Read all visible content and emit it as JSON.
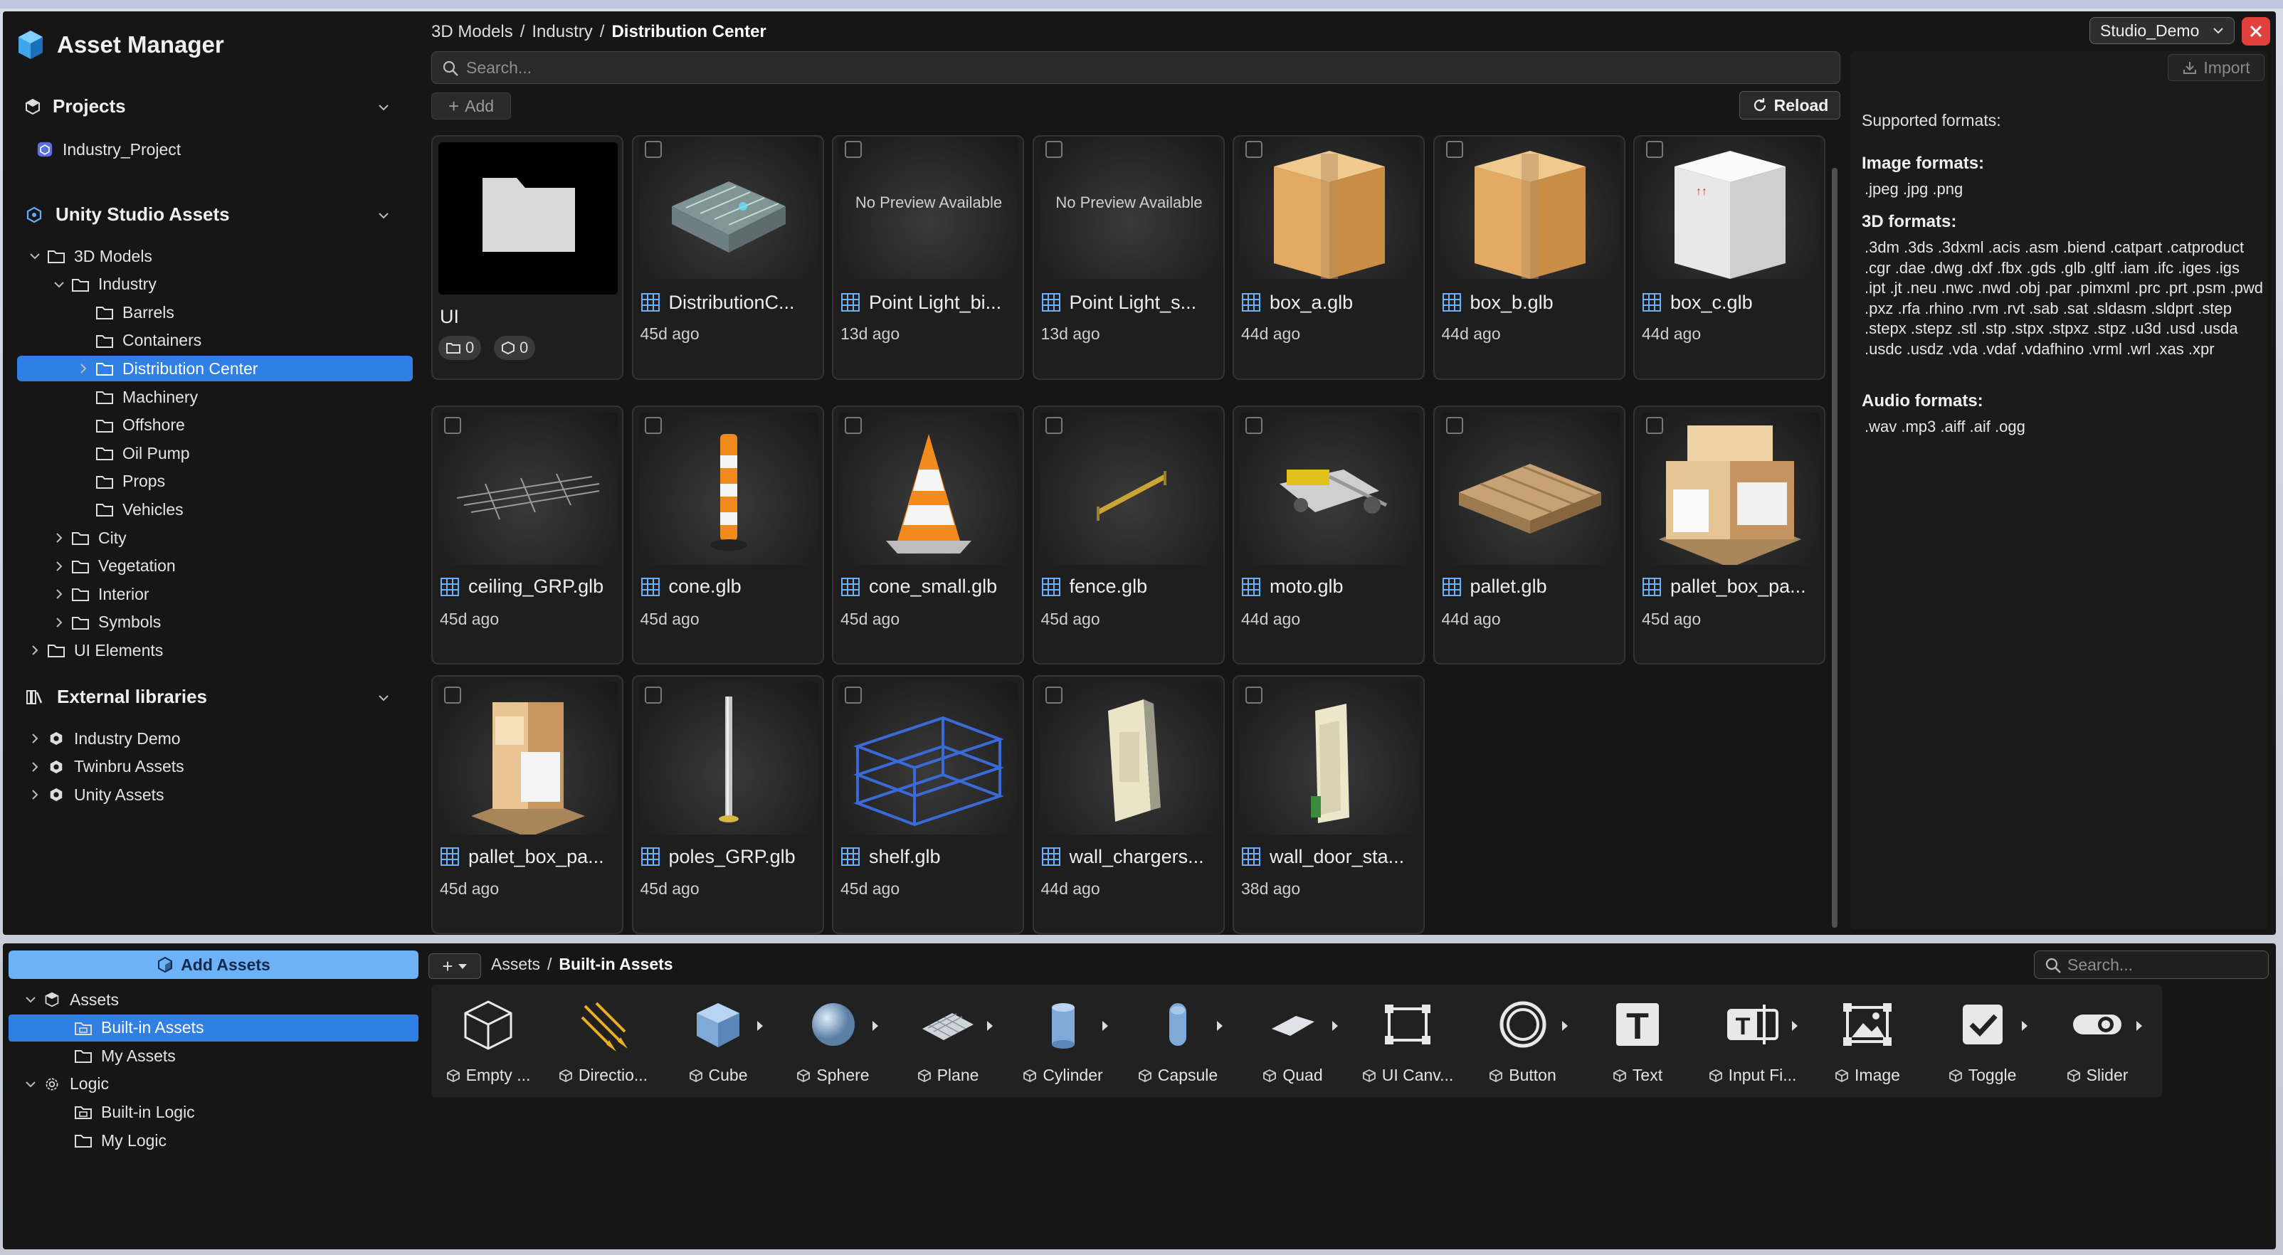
{
  "app_title": "Asset Manager",
  "sidebar": {
    "projects": {
      "label": "Projects",
      "items": [
        "Industry_Project"
      ]
    },
    "studio_assets": {
      "label": "Unity Studio Assets",
      "tree": [
        {
          "label": "3D Models",
          "level": 0,
          "expanded": true
        },
        {
          "label": "Industry",
          "level": 1,
          "expanded": true
        },
        {
          "label": "Barrels",
          "level": 2
        },
        {
          "label": "Containers",
          "level": 2
        },
        {
          "label": "Distribution Center",
          "level": 2,
          "selected": true,
          "collapsed": true
        },
        {
          "label": "Machinery",
          "level": 2
        },
        {
          "label": "Offshore",
          "level": 2
        },
        {
          "label": "Oil Pump",
          "level": 2
        },
        {
          "label": "Props",
          "level": 2
        },
        {
          "label": "Vehicles",
          "level": 2
        },
        {
          "label": "City",
          "level": 1,
          "collapsed": true
        },
        {
          "label": "Vegetation",
          "level": 1,
          "collapsed": true
        },
        {
          "label": "Interior",
          "level": 1,
          "collapsed": true
        },
        {
          "label": "Symbols",
          "level": 1,
          "collapsed": true
        },
        {
          "label": "UI Elements",
          "level": 0,
          "collapsed": true
        }
      ]
    },
    "external": {
      "label": "External libraries",
      "items": [
        "Industry Demo",
        "Twinbru Assets",
        "Unity Assets"
      ]
    }
  },
  "breadcrumb": {
    "parts": [
      "3D Models",
      "Industry"
    ],
    "current": "Distribution Center"
  },
  "search": {
    "placeholder": "Search..."
  },
  "toolbar": {
    "add": "Add",
    "reload": "Reload"
  },
  "workspace": {
    "selected": "Studio_Demo"
  },
  "right_panel": {
    "import": "Import",
    "supported": "Supported formats:",
    "image_h": "Image formats:",
    "image_v": ".jpeg .jpg .png",
    "d3_h": "3D formats:",
    "d3_v": ".3dm .3ds .3dxml .acis .asm .biend .catpart .catproduct .cgr .dae .dwg .dxf .fbx .gds .glb .gltf .iam .ifc .iges .igs .ipt .jt .neu .nwc .nwd .obj .par .pimxml .prc .prt .psm .pwd .pxz .rfa .rhino .rvm .rvt .sab .sat .sldasm .sldprt .step .stepx .stepz .stl .stp .stpx .stpxz .stpz .u3d .usd .usda .usdc .usdz .vda .vdaf .vdafhino .vrml .wrl .xas .xpr",
    "audio_h": "Audio formats:",
    "audio_v": ".wav .mp3 .aiff .aif .ogg"
  },
  "assets": [
    {
      "name": "UI",
      "kind": "folder",
      "folders": "0",
      "meshes": "0"
    },
    {
      "name": "DistributionC...",
      "age": "45d ago",
      "thumb": "dc"
    },
    {
      "name": "Point Light_bi...",
      "age": "13d ago",
      "thumb": "none",
      "no_preview": "No Preview Available"
    },
    {
      "name": "Point Light_s...",
      "age": "13d ago",
      "thumb": "none",
      "no_preview": "No Preview Available"
    },
    {
      "name": "box_a.glb",
      "age": "44d ago",
      "thumb": "box"
    },
    {
      "name": "box_b.glb",
      "age": "44d ago",
      "thumb": "box"
    },
    {
      "name": "box_c.glb",
      "age": "44d ago",
      "thumb": "boxw"
    },
    {
      "name": "ceiling_GRP.glb",
      "age": "45d ago",
      "thumb": "ceiling"
    },
    {
      "name": "cone.glb",
      "age": "45d ago",
      "thumb": "pole"
    },
    {
      "name": "cone_small.glb",
      "age": "45d ago",
      "thumb": "cone"
    },
    {
      "name": "fence.glb",
      "age": "45d ago",
      "thumb": "fence"
    },
    {
      "name": "moto.glb",
      "age": "44d ago",
      "thumb": "moto"
    },
    {
      "name": "pallet.glb",
      "age": "44d ago",
      "thumb": "pallet"
    },
    {
      "name": "pallet_box_pa...",
      "age": "45d ago",
      "thumb": "stack"
    },
    {
      "name": "pallet_box_pa...",
      "age": "45d ago",
      "thumb": "stack2"
    },
    {
      "name": "poles_GRP.glb",
      "age": "45d ago",
      "thumb": "poles"
    },
    {
      "name": "shelf.glb",
      "age": "45d ago",
      "thumb": "shelf"
    },
    {
      "name": "wall_chargers...",
      "age": "44d ago",
      "thumb": "charger"
    },
    {
      "name": "wall_door_sta...",
      "age": "38d ago",
      "thumb": "door"
    }
  ],
  "bottom": {
    "add_assets": "Add Assets",
    "tree": [
      {
        "label": "Assets",
        "level": 0,
        "icon": "cube"
      },
      {
        "label": "Built-in Assets",
        "level": 1,
        "icon": "folder-store",
        "selected": true
      },
      {
        "label": "My Assets",
        "level": 1,
        "icon": "folder"
      },
      {
        "label": "Logic",
        "level": 0,
        "icon": "gear"
      },
      {
        "label": "Built-in Logic",
        "level": 1,
        "icon": "folder-store"
      },
      {
        "label": "My Logic",
        "level": 1,
        "icon": "folder"
      }
    ],
    "breadcrumb": {
      "parent": "Assets",
      "current": "Built-in Assets"
    },
    "search_placeholder": "Search...",
    "tools": [
      {
        "label": "Empty ...",
        "icon": "empty-cube",
        "arrow": false
      },
      {
        "label": "Directio...",
        "icon": "directional-light",
        "arrow": false
      },
      {
        "label": "Cube",
        "icon": "cube",
        "arrow": true
      },
      {
        "label": "Sphere",
        "icon": "sphere",
        "arrow": true
      },
      {
        "label": "Plane",
        "icon": "plane",
        "arrow": true
      },
      {
        "label": "Cylinder",
        "icon": "cylinder",
        "arrow": true
      },
      {
        "label": "Capsule",
        "icon": "capsule",
        "arrow": true
      },
      {
        "label": "Quad",
        "icon": "quad",
        "arrow": true
      },
      {
        "label": "UI Canv...",
        "icon": "ui-canvas",
        "arrow": false
      },
      {
        "label": "Button",
        "icon": "button",
        "arrow": true
      },
      {
        "label": "Text",
        "icon": "text",
        "arrow": false
      },
      {
        "label": "Input Fi...",
        "icon": "input-field",
        "arrow": true
      },
      {
        "label": "Image",
        "icon": "image",
        "arrow": false
      },
      {
        "label": "Toggle",
        "icon": "toggle",
        "arrow": true
      },
      {
        "label": "Slider",
        "icon": "slider",
        "arrow": true
      }
    ]
  },
  "colors": {
    "accent": "#2f7fe4",
    "close": "#e0413c",
    "add_assets": "#6db2f7"
  }
}
